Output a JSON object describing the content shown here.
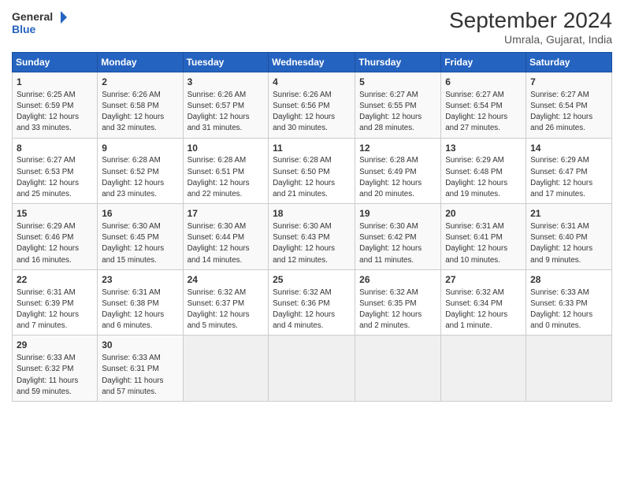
{
  "header": {
    "logo_general": "General",
    "logo_blue": "Blue",
    "month": "September 2024",
    "location": "Umrala, Gujarat, India"
  },
  "days_of_week": [
    "Sunday",
    "Monday",
    "Tuesday",
    "Wednesday",
    "Thursday",
    "Friday",
    "Saturday"
  ],
  "weeks": [
    [
      {
        "day": "1",
        "lines": [
          "Sunrise: 6:25 AM",
          "Sunset: 6:59 PM",
          "Daylight: 12 hours",
          "and 33 minutes."
        ]
      },
      {
        "day": "2",
        "lines": [
          "Sunrise: 6:26 AM",
          "Sunset: 6:58 PM",
          "Daylight: 12 hours",
          "and 32 minutes."
        ]
      },
      {
        "day": "3",
        "lines": [
          "Sunrise: 6:26 AM",
          "Sunset: 6:57 PM",
          "Daylight: 12 hours",
          "and 31 minutes."
        ]
      },
      {
        "day": "4",
        "lines": [
          "Sunrise: 6:26 AM",
          "Sunset: 6:56 PM",
          "Daylight: 12 hours",
          "and 30 minutes."
        ]
      },
      {
        "day": "5",
        "lines": [
          "Sunrise: 6:27 AM",
          "Sunset: 6:55 PM",
          "Daylight: 12 hours",
          "and 28 minutes."
        ]
      },
      {
        "day": "6",
        "lines": [
          "Sunrise: 6:27 AM",
          "Sunset: 6:54 PM",
          "Daylight: 12 hours",
          "and 27 minutes."
        ]
      },
      {
        "day": "7",
        "lines": [
          "Sunrise: 6:27 AM",
          "Sunset: 6:54 PM",
          "Daylight: 12 hours",
          "and 26 minutes."
        ]
      }
    ],
    [
      {
        "day": "8",
        "lines": [
          "Sunrise: 6:27 AM",
          "Sunset: 6:53 PM",
          "Daylight: 12 hours",
          "and 25 minutes."
        ]
      },
      {
        "day": "9",
        "lines": [
          "Sunrise: 6:28 AM",
          "Sunset: 6:52 PM",
          "Daylight: 12 hours",
          "and 23 minutes."
        ]
      },
      {
        "day": "10",
        "lines": [
          "Sunrise: 6:28 AM",
          "Sunset: 6:51 PM",
          "Daylight: 12 hours",
          "and 22 minutes."
        ]
      },
      {
        "day": "11",
        "lines": [
          "Sunrise: 6:28 AM",
          "Sunset: 6:50 PM",
          "Daylight: 12 hours",
          "and 21 minutes."
        ]
      },
      {
        "day": "12",
        "lines": [
          "Sunrise: 6:28 AM",
          "Sunset: 6:49 PM",
          "Daylight: 12 hours",
          "and 20 minutes."
        ]
      },
      {
        "day": "13",
        "lines": [
          "Sunrise: 6:29 AM",
          "Sunset: 6:48 PM",
          "Daylight: 12 hours",
          "and 19 minutes."
        ]
      },
      {
        "day": "14",
        "lines": [
          "Sunrise: 6:29 AM",
          "Sunset: 6:47 PM",
          "Daylight: 12 hours",
          "and 17 minutes."
        ]
      }
    ],
    [
      {
        "day": "15",
        "lines": [
          "Sunrise: 6:29 AM",
          "Sunset: 6:46 PM",
          "Daylight: 12 hours",
          "and 16 minutes."
        ]
      },
      {
        "day": "16",
        "lines": [
          "Sunrise: 6:30 AM",
          "Sunset: 6:45 PM",
          "Daylight: 12 hours",
          "and 15 minutes."
        ]
      },
      {
        "day": "17",
        "lines": [
          "Sunrise: 6:30 AM",
          "Sunset: 6:44 PM",
          "Daylight: 12 hours",
          "and 14 minutes."
        ]
      },
      {
        "day": "18",
        "lines": [
          "Sunrise: 6:30 AM",
          "Sunset: 6:43 PM",
          "Daylight: 12 hours",
          "and 12 minutes."
        ]
      },
      {
        "day": "19",
        "lines": [
          "Sunrise: 6:30 AM",
          "Sunset: 6:42 PM",
          "Daylight: 12 hours",
          "and 11 minutes."
        ]
      },
      {
        "day": "20",
        "lines": [
          "Sunrise: 6:31 AM",
          "Sunset: 6:41 PM",
          "Daylight: 12 hours",
          "and 10 minutes."
        ]
      },
      {
        "day": "21",
        "lines": [
          "Sunrise: 6:31 AM",
          "Sunset: 6:40 PM",
          "Daylight: 12 hours",
          "and 9 minutes."
        ]
      }
    ],
    [
      {
        "day": "22",
        "lines": [
          "Sunrise: 6:31 AM",
          "Sunset: 6:39 PM",
          "Daylight: 12 hours",
          "and 7 minutes."
        ]
      },
      {
        "day": "23",
        "lines": [
          "Sunrise: 6:31 AM",
          "Sunset: 6:38 PM",
          "Daylight: 12 hours",
          "and 6 minutes."
        ]
      },
      {
        "day": "24",
        "lines": [
          "Sunrise: 6:32 AM",
          "Sunset: 6:37 PM",
          "Daylight: 12 hours",
          "and 5 minutes."
        ]
      },
      {
        "day": "25",
        "lines": [
          "Sunrise: 6:32 AM",
          "Sunset: 6:36 PM",
          "Daylight: 12 hours",
          "and 4 minutes."
        ]
      },
      {
        "day": "26",
        "lines": [
          "Sunrise: 6:32 AM",
          "Sunset: 6:35 PM",
          "Daylight: 12 hours",
          "and 2 minutes."
        ]
      },
      {
        "day": "27",
        "lines": [
          "Sunrise: 6:32 AM",
          "Sunset: 6:34 PM",
          "Daylight: 12 hours",
          "and 1 minute."
        ]
      },
      {
        "day": "28",
        "lines": [
          "Sunrise: 6:33 AM",
          "Sunset: 6:33 PM",
          "Daylight: 12 hours",
          "and 0 minutes."
        ]
      }
    ],
    [
      {
        "day": "29",
        "lines": [
          "Sunrise: 6:33 AM",
          "Sunset: 6:32 PM",
          "Daylight: 11 hours",
          "and 59 minutes."
        ]
      },
      {
        "day": "30",
        "lines": [
          "Sunrise: 6:33 AM",
          "Sunset: 6:31 PM",
          "Daylight: 11 hours",
          "and 57 minutes."
        ]
      },
      {
        "day": "",
        "lines": []
      },
      {
        "day": "",
        "lines": []
      },
      {
        "day": "",
        "lines": []
      },
      {
        "day": "",
        "lines": []
      },
      {
        "day": "",
        "lines": []
      }
    ]
  ]
}
